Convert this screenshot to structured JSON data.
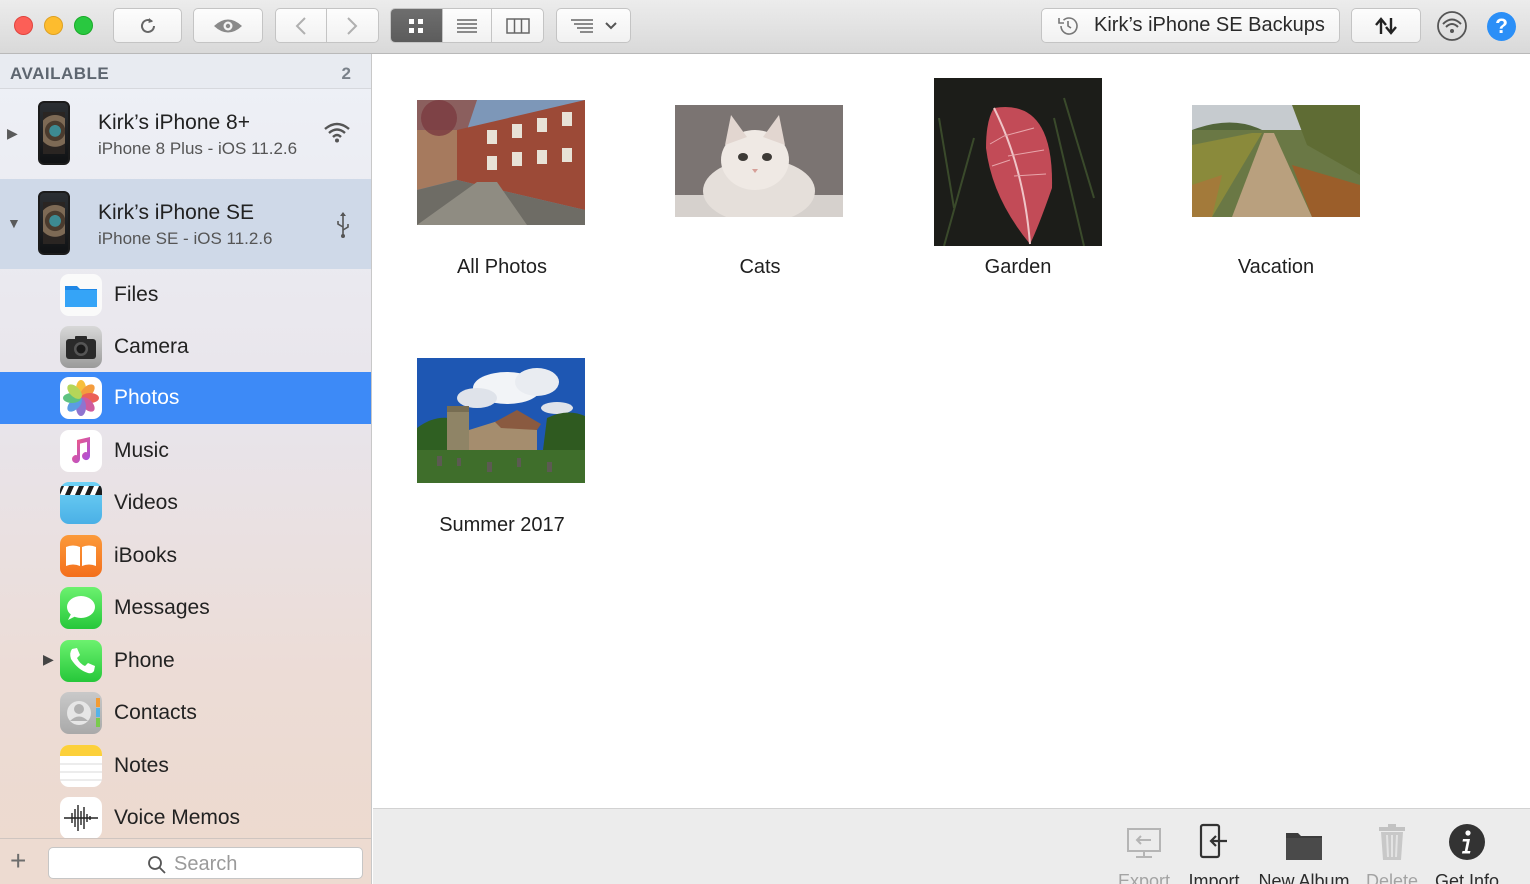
{
  "toolbar": {
    "backups_label": "Kirk’s iPhone SE Backups",
    "icons": [
      "refresh-icon",
      "eye-icon",
      "chevron-left-icon",
      "chevron-right-icon",
      "grid-view-icon",
      "list-view-icon",
      "column-view-icon",
      "sort-icon",
      "chevron-down-icon",
      "history-icon",
      "transfer-icon",
      "wifi-sync-icon",
      "help-icon"
    ],
    "help_glyph": "?"
  },
  "sidebar": {
    "section_label": "AVAILABLE",
    "section_count": "2",
    "devices": [
      {
        "name": "Kirk’s iPhone 8+",
        "subtitle": "iPhone 8 Plus - iOS 11.2.6",
        "connection": "wifi"
      },
      {
        "name": "Kirk’s iPhone SE",
        "subtitle": "iPhone SE - iOS 11.2.6",
        "connection": "usb"
      }
    ],
    "apps": [
      {
        "label": "Files",
        "icon": "files-icon"
      },
      {
        "label": "Camera",
        "icon": "camera-icon"
      },
      {
        "label": "Photos",
        "icon": "photos-icon"
      },
      {
        "label": "Music",
        "icon": "music-icon"
      },
      {
        "label": "Videos",
        "icon": "videos-icon"
      },
      {
        "label": "iBooks",
        "icon": "ibooks-icon"
      },
      {
        "label": "Messages",
        "icon": "messages-icon"
      },
      {
        "label": "Phone",
        "icon": "phone-icon"
      },
      {
        "label": "Contacts",
        "icon": "contacts-icon"
      },
      {
        "label": "Notes",
        "icon": "notes-icon"
      },
      {
        "label": "Voice Memos",
        "icon": "voice-memos-icon"
      }
    ],
    "selected_app": "Photos",
    "search_placeholder": "Search"
  },
  "main": {
    "albums": [
      {
        "title": "All Photos"
      },
      {
        "title": "Cats"
      },
      {
        "title": "Garden"
      },
      {
        "title": "Vacation"
      },
      {
        "title": "Summer 2017"
      }
    ]
  },
  "actions": [
    {
      "label": "Export",
      "enabled": false
    },
    {
      "label": "Import",
      "enabled": true
    },
    {
      "label": "New Album",
      "enabled": true
    },
    {
      "label": "Delete",
      "enabled": false
    },
    {
      "label": "Get Info",
      "enabled": true
    }
  ],
  "colors": {
    "selection": "#3d8af7",
    "help": "#2b8ff7"
  }
}
